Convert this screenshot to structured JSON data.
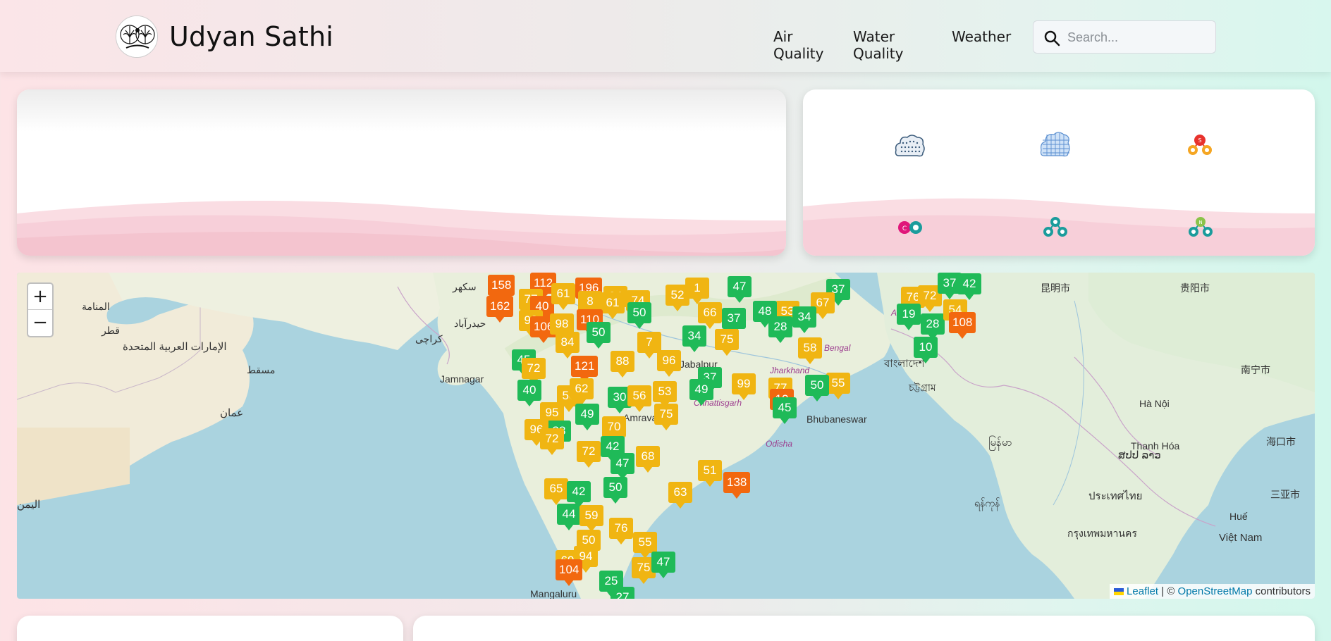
{
  "header": {
    "brand": "Udyan Sathi",
    "nav": [
      {
        "label": "Air Quality"
      },
      {
        "label": "Water Quality"
      },
      {
        "label": "Weather"
      }
    ],
    "search_placeholder": "Search..."
  },
  "pollutant_icons": [
    "pm10-icon",
    "pm25-icon",
    "so2-icon",
    "co-icon",
    "o3-icon",
    "no2-icon"
  ],
  "colors": {
    "good": "#1fba58",
    "moderate": "#f0b512",
    "poor": "#f2680f"
  },
  "map": {
    "zoom_in": "+",
    "zoom_out": "−",
    "attribution": {
      "leaflet": "Leaflet",
      "separator": " | © ",
      "osm": "OpenStreetMap",
      "suffix": " contributors"
    },
    "markers": [
      {
        "v": "158",
        "c": "orange"
      },
      {
        "v": "112",
        "c": "orange"
      },
      {
        "v": "196",
        "c": "orange"
      },
      {
        "v": "162",
        "c": "orange"
      },
      {
        "v": "77",
        "c": "yellow"
      },
      {
        "v": "40",
        "c": "orange"
      },
      {
        "v": "61",
        "c": "yellow"
      },
      {
        "v": "8",
        "c": "yellow"
      },
      {
        "v": "04",
        "c": "yellow"
      },
      {
        "v": "61",
        "c": "yellow"
      },
      {
        "v": "74",
        "c": "yellow"
      },
      {
        "v": "52",
        "c": "yellow"
      },
      {
        "v": "1",
        "c": "yellow"
      },
      {
        "v": "47",
        "c": "green"
      },
      {
        "v": "37",
        "c": "green"
      },
      {
        "v": "67",
        "c": "yellow"
      },
      {
        "v": "76",
        "c": "yellow"
      },
      {
        "v": "72",
        "c": "yellow"
      },
      {
        "v": "37",
        "c": "green"
      },
      {
        "v": "42",
        "c": "green"
      },
      {
        "v": "53",
        "c": "yellow"
      },
      {
        "v": "93",
        "c": "yellow"
      },
      {
        "v": "106",
        "c": "orange"
      },
      {
        "v": "98",
        "c": "yellow"
      },
      {
        "v": "110",
        "c": "orange"
      },
      {
        "v": "50",
        "c": "green"
      },
      {
        "v": "66",
        "c": "yellow"
      },
      {
        "v": "37",
        "c": "green"
      },
      {
        "v": "48",
        "c": "green"
      },
      {
        "v": "28",
        "c": "green"
      },
      {
        "v": "34",
        "c": "green"
      },
      {
        "v": "19",
        "c": "green"
      },
      {
        "v": "28",
        "c": "green"
      },
      {
        "v": "54",
        "c": "yellow"
      },
      {
        "v": "108",
        "c": "orange"
      },
      {
        "v": "50",
        "c": "green"
      },
      {
        "v": "75",
        "c": "yellow"
      },
      {
        "v": "7",
        "c": "yellow"
      },
      {
        "v": "84",
        "c": "yellow"
      },
      {
        "v": "34",
        "c": "green"
      },
      {
        "v": "75",
        "c": "yellow"
      },
      {
        "v": "58",
        "c": "yellow"
      },
      {
        "v": "10",
        "c": "green"
      },
      {
        "v": "45",
        "c": "green"
      },
      {
        "v": "72",
        "c": "yellow"
      },
      {
        "v": "121",
        "c": "orange"
      },
      {
        "v": "88",
        "c": "yellow"
      },
      {
        "v": "96",
        "c": "yellow"
      },
      {
        "v": "37",
        "c": "green"
      },
      {
        "v": "99",
        "c": "yellow"
      },
      {
        "v": "77",
        "c": "yellow"
      },
      {
        "v": "55",
        "c": "yellow"
      },
      {
        "v": "40",
        "c": "green"
      },
      {
        "v": "58",
        "c": "yellow"
      },
      {
        "v": "62",
        "c": "yellow"
      },
      {
        "v": "30",
        "c": "green"
      },
      {
        "v": "56",
        "c": "yellow"
      },
      {
        "v": "53",
        "c": "yellow"
      },
      {
        "v": "49",
        "c": "green"
      },
      {
        "v": "10",
        "c": "orange"
      },
      {
        "v": "50",
        "c": "green"
      },
      {
        "v": "95",
        "c": "yellow"
      },
      {
        "v": "49",
        "c": "green"
      },
      {
        "v": "75",
        "c": "yellow"
      },
      {
        "v": "45",
        "c": "green"
      },
      {
        "v": "38",
        "c": "green"
      },
      {
        "v": "70",
        "c": "yellow"
      },
      {
        "v": "96",
        "c": "yellow"
      },
      {
        "v": "72",
        "c": "yellow"
      },
      {
        "v": "42",
        "c": "green"
      },
      {
        "v": "72",
        "c": "yellow"
      },
      {
        "v": "47",
        "c": "green"
      },
      {
        "v": "68",
        "c": "yellow"
      },
      {
        "v": "138",
        "c": "orange"
      },
      {
        "v": "51",
        "c": "yellow"
      },
      {
        "v": "65",
        "c": "yellow"
      },
      {
        "v": "50",
        "c": "green"
      },
      {
        "v": "42",
        "c": "green"
      },
      {
        "v": "63",
        "c": "yellow"
      },
      {
        "v": "44",
        "c": "green"
      },
      {
        "v": "59",
        "c": "yellow"
      },
      {
        "v": "76",
        "c": "yellow"
      },
      {
        "v": "50",
        "c": "yellow"
      },
      {
        "v": "55",
        "c": "yellow"
      },
      {
        "v": "69",
        "c": "yellow"
      },
      {
        "v": "94",
        "c": "yellow"
      },
      {
        "v": "104",
        "c": "orange"
      },
      {
        "v": "75",
        "c": "yellow"
      },
      {
        "v": "25",
        "c": "green"
      },
      {
        "v": "27",
        "c": "green"
      },
      {
        "v": "47",
        "c": "green"
      }
    ],
    "labels": {
      "sukkur": "سکھر",
      "hyderabad": "حیدرآباد",
      "karachi": "کراچی",
      "jamnagar": "Jamnagar",
      "jabalpur": "Jabalpur",
      "bhubaneswar": "Bhubaneswar",
      "nagpur": "Chhattisgarh",
      "odisha": "Odisha",
      "jharkhand": "Jharkhand",
      "bengal": "Bengal",
      "mangaluru": "Mangaluru",
      "amravati": "Amravat",
      "assam": "Assam",
      "manama": "المنامة",
      "qatar": "قطر",
      "uae": "الإمارات العربية المتحدة",
      "oman": "عمان",
      "muscat": "مسقط",
      "yemen": "اليمن",
      "bangladesh": "বাংলাদেশ",
      "myanmar": "မြန်မာ",
      "thailand": "ประเทศไทย",
      "laos": "ສປປ ລາວ",
      "hanoi": "Hà Nội",
      "vietnam": "Việt Nam",
      "hue": "Huế",
      "bangkok": "กรุงเทพมหานคร",
      "kunming": "昆明市",
      "guiyang": "贵阳市",
      "nanning": "南宁市",
      "haikou": "海口市",
      "sanya": "三亚市",
      "thanhhoa": "Thanh Hóa",
      "chittagong": "চট্টগ্রাম",
      "yangon": "ရန်ကုန်"
    }
  }
}
